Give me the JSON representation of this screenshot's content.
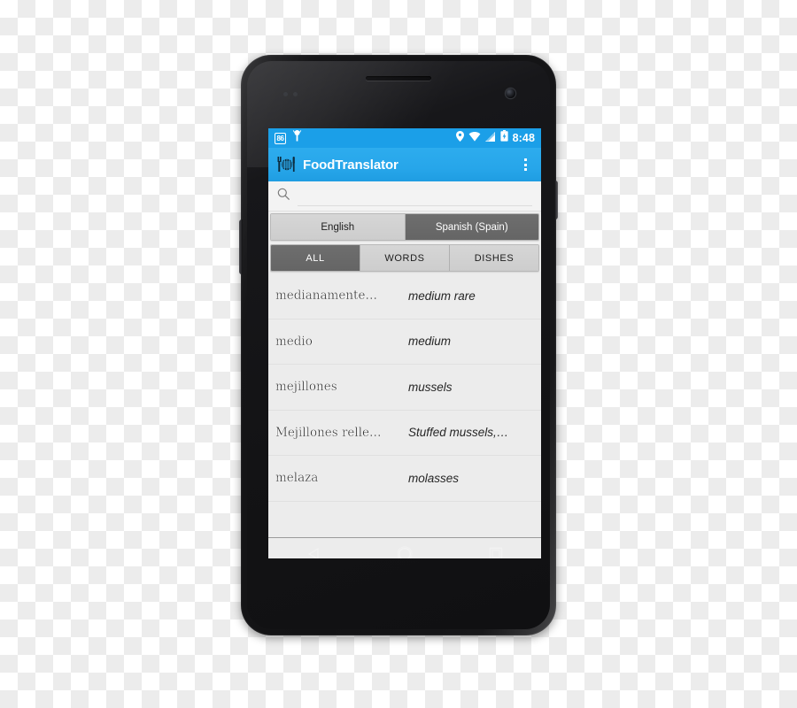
{
  "device": {
    "name": "android-phone-mockup"
  },
  "status_bar": {
    "left_icons": [
      {
        "name": "data-badge-icon",
        "label": "86"
      },
      {
        "name": "android-usb-icon",
        "label": ""
      }
    ],
    "right_icons": [
      {
        "name": "location-pin-icon"
      },
      {
        "name": "wifi-icon"
      },
      {
        "name": "signal-bars-icon"
      },
      {
        "name": "battery-charging-icon"
      }
    ],
    "time": "8:48"
  },
  "action_bar": {
    "app_icon": "food-plate-fork-knife-icon",
    "title": "FoodTranslator",
    "overflow_icon": "overflow-menu-icon"
  },
  "search": {
    "icon": "search-icon",
    "value": "",
    "placeholder": ""
  },
  "language_tabs": {
    "items": [
      {
        "label": "English",
        "selected": false
      },
      {
        "label": "Spanish (Spain)",
        "selected": true
      }
    ]
  },
  "filter_tabs": {
    "items": [
      {
        "label": "ALL",
        "selected": true
      },
      {
        "label": "WORDS",
        "selected": false
      },
      {
        "label": "DISHES",
        "selected": false
      }
    ]
  },
  "list": {
    "rows": [
      {
        "term": "medianamente…",
        "translation": "medium rare"
      },
      {
        "term": "medio",
        "translation": "medium"
      },
      {
        "term": "mejillones",
        "translation": "mussels"
      },
      {
        "term": "Mejillones relle…",
        "translation": "Stuffed mussels,…"
      },
      {
        "term": "melaza",
        "translation": "molasses"
      }
    ]
  },
  "nav_bar": {
    "buttons": [
      {
        "name": "nav-back-button",
        "icon": "back-triangle-icon"
      },
      {
        "name": "nav-home-button",
        "icon": "home-circle-icon"
      },
      {
        "name": "nav-recents-button",
        "icon": "recents-square-icon"
      }
    ]
  },
  "colors": {
    "accent_blue": "#1b9fe8",
    "action_bar_blue": "#27a6ea",
    "selected_tab_gray": "#6e6e6e",
    "unselected_tab_gray": "#d2d2d2",
    "list_background": "#ececec"
  }
}
